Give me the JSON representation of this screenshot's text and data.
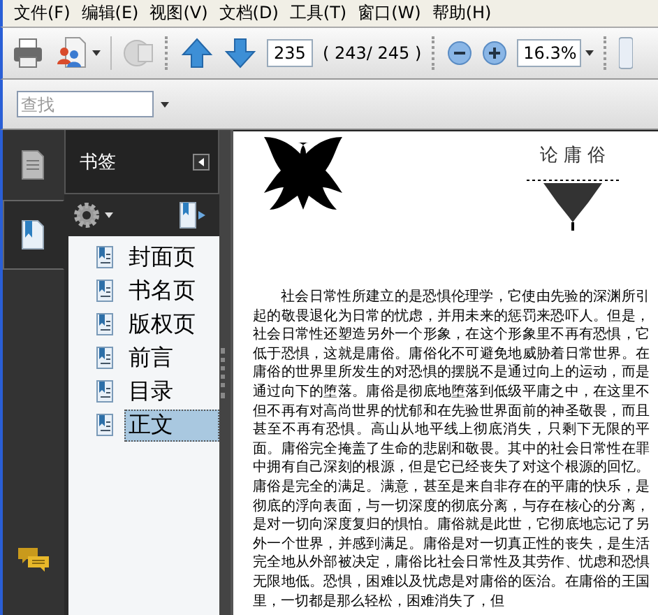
{
  "menu": [
    "文件(F)",
    "编辑(E)",
    "视图(V)",
    "文档(D)",
    "工具(T)",
    "窗口(W)",
    "帮助(H)"
  ],
  "toolbar": {
    "page_number": "235",
    "page_count": "( 243/ 245 )",
    "zoom": "16.3%"
  },
  "find": {
    "placeholder": "查找"
  },
  "nav_tabs": [
    {
      "kind": "pages",
      "selected": false
    },
    {
      "kind": "bookmarks",
      "selected": true
    }
  ],
  "sidebar": {
    "title": "书签",
    "bookmarks": [
      {
        "label": "封面页",
        "selected": false
      },
      {
        "label": "书名页",
        "selected": false
      },
      {
        "label": "版权页",
        "selected": false
      },
      {
        "label": "前言",
        "selected": false
      },
      {
        "label": "目录",
        "selected": false
      },
      {
        "label": "正文",
        "selected": true
      }
    ]
  },
  "document": {
    "heading": "论 庸 俗",
    "paragraph": "社会日常性所建立的是恐惧伦理学，它使由先验的深渊所引起的敬畏退化为日常的忧虑，并用未来的惩罚来恐吓人。但是，社会日常性还塑造另外一个形象，在这个形象里不再有恐惧，它低于恐惧，这就是庸俗。庸俗化不可避免地威胁着日常世界。在庸俗的世界里所发生的对恐惧的摆脱不是通过向上的运动，而是通过向下的堕落。庸俗是彻底地堕落到低级平庸之中，在这里不但不再有对高尚世界的忧郁和在先验世界面前的神圣敬畏，而且甚至不再有恐惧。高山从地平线上彻底消失，只剩下无限的平面。庸俗完全掩盖了生命的悲剧和敬畏。其中的社会日常性在罪中拥有自己深刻的根源，但是它已经丧失了对这个根源的回忆。庸俗是完全的满足。满意，甚至是来自非存在的平庸的快乐，是彻底的浮向表面，与一切深度的彻底分离，与存在核心的分离，是对一切向深度复归的惧怕。庸俗就是此世，它彻底地忘记了另外一个世界，并感到满足。庸俗是对一切真正性的丧失，是生活完全地从外部被决定，庸俗比社会日常性及其劳作、忧虑和恐惧无限地低。恐惧，困难以及忧虑是对庸俗的医治。在庸俗的王国里，一切都是那么轻松，困难消失了，但"
  }
}
